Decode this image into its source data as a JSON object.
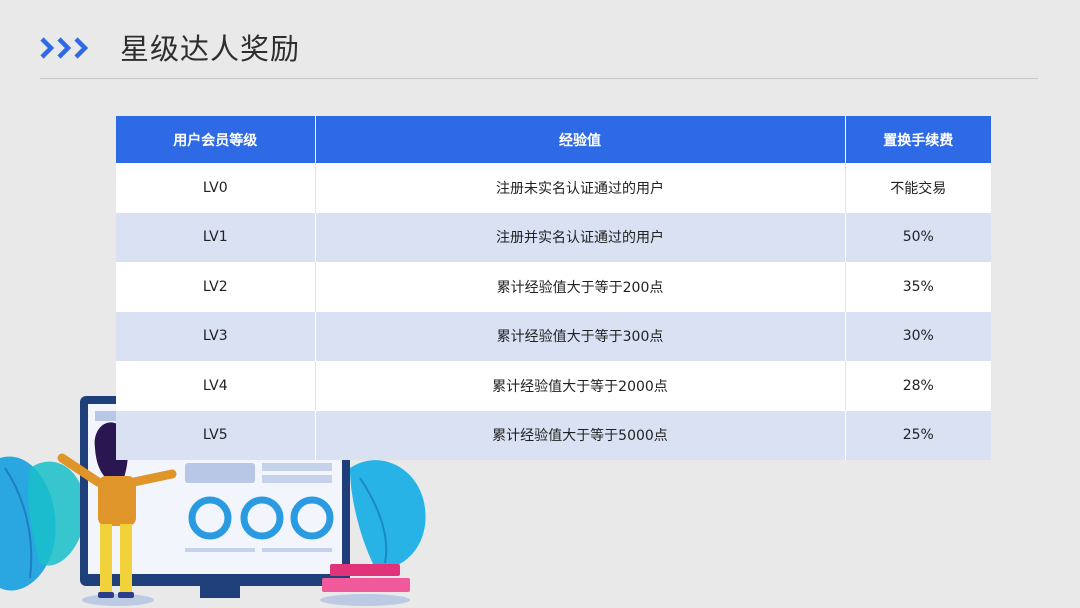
{
  "header": {
    "title": "星级达人奖励",
    "accent_color": "#2f6ae6",
    "chevron_icon": "triple-chevron-right-icon"
  },
  "table": {
    "columns": [
      "用户会员等级",
      "经验值",
      "置换手续费"
    ],
    "rows": [
      [
        "LV0",
        "注册未实名认证通过的用户",
        "不能交易"
      ],
      [
        "LV1",
        "注册并实名认证通过的用户",
        "50%"
      ],
      [
        "LV2",
        "累计经验值大于等于200点",
        "35%"
      ],
      [
        "LV3",
        "累计经验值大于等于300点",
        "30%"
      ],
      [
        "LV4",
        "累计经验值大于等于2000点",
        "28%"
      ],
      [
        "LV5",
        "累计经验值大于等于5000点",
        "25%"
      ]
    ],
    "header_color": "#2f6ae6",
    "stripe_color": "#d9e1f3"
  },
  "illustration": {
    "icon": "dashboard-monitor-with-woman-illustration"
  }
}
